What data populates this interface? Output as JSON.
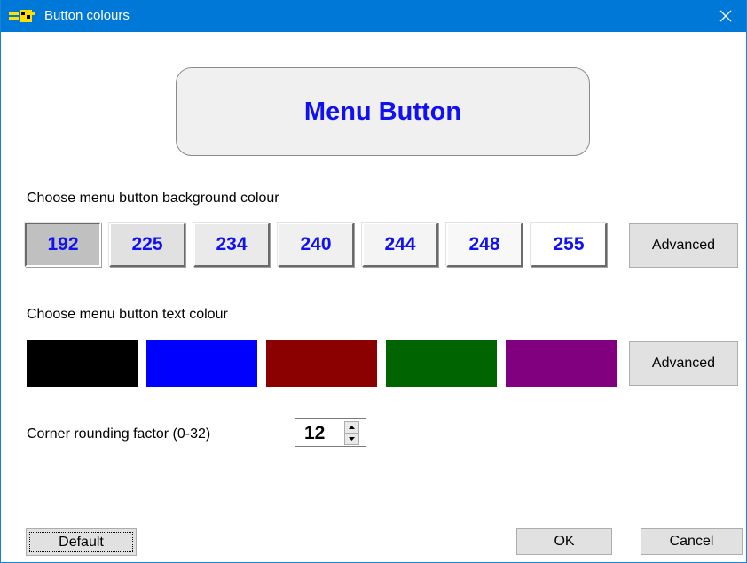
{
  "window": {
    "title": "Button colours",
    "app_icon": "app-icon",
    "close_icon": "close-icon"
  },
  "preview": {
    "label": "Menu Button",
    "text_color": "#1010f0",
    "background_color": "#f0f0f0",
    "corner_rounding": 12
  },
  "background_section": {
    "label": "Choose menu button background colour",
    "swatches": [
      {
        "value": "192",
        "color": "#c0c0c0",
        "selected": true
      },
      {
        "value": "225",
        "color": "#e1e1e1",
        "selected": false
      },
      {
        "value": "234",
        "color": "#eaeaea",
        "selected": false
      },
      {
        "value": "240",
        "color": "#f0f0f0",
        "selected": false
      },
      {
        "value": "244",
        "color": "#f4f4f4",
        "selected": false
      },
      {
        "value": "248",
        "color": "#f8f8f8",
        "selected": false
      },
      {
        "value": "255",
        "color": "#ffffff",
        "selected": false
      }
    ],
    "advanced_label": "Advanced"
  },
  "text_section": {
    "label": "Choose menu button text colour",
    "colors": [
      "#000000",
      "#0000ff",
      "#8b0000",
      "#006400",
      "#800080"
    ],
    "advanced_label": "Advanced"
  },
  "corner": {
    "label": "Corner rounding factor (0-32)",
    "value": "12"
  },
  "footer": {
    "default_label": "Default",
    "ok_label": "OK",
    "cancel_label": "Cancel"
  }
}
